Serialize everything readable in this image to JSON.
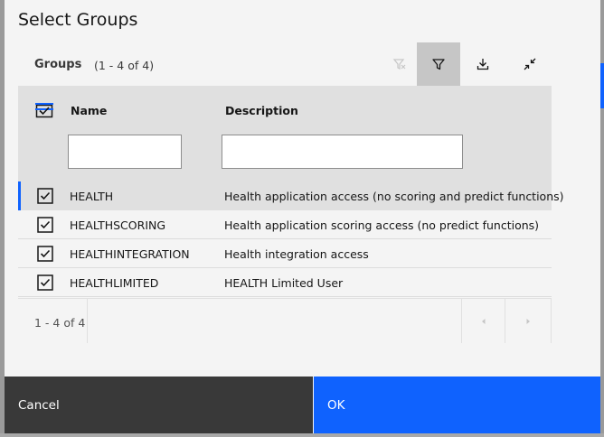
{
  "modal": {
    "title": "Select Groups"
  },
  "toolbar": {
    "title": "Groups",
    "count": "(1 - 4 of 4)",
    "buttons": [
      "clear-filter-icon",
      "filter-icon",
      "download-icon",
      "collapse-icon"
    ]
  },
  "table": {
    "columns": [
      "Name",
      "Description"
    ],
    "filters": {
      "name": "",
      "description": ""
    },
    "rows": [
      {
        "name": "HEALTH",
        "description": "Health application access (no scoring and predict functions)",
        "checked": true,
        "selected": true
      },
      {
        "name": "HEALTHSCORING",
        "description": "Health application scoring access (no predict functions)",
        "checked": true,
        "selected": false
      },
      {
        "name": "HEALTHINTEGRATION",
        "description": "Health integration access",
        "checked": true,
        "selected": false
      },
      {
        "name": "HEALTHLIMITED",
        "description": "HEALTH Limited User",
        "checked": true,
        "selected": false
      }
    ]
  },
  "pagination": {
    "text": "1 - 4 of 4"
  },
  "footer": {
    "cancel_label": "Cancel",
    "ok_label": "OK"
  },
  "colors": {
    "accent": "#0f62fe",
    "secondary_button": "#393939",
    "header_bg": "#e0e0e0"
  }
}
